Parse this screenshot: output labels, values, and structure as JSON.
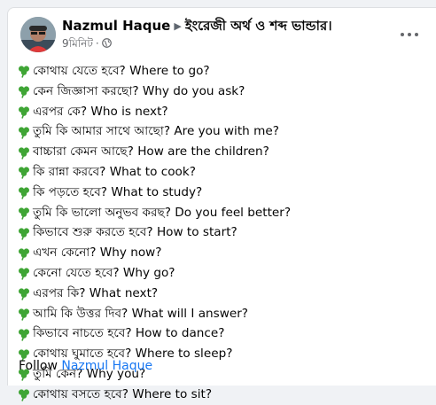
{
  "post": {
    "author": "Nazmul Haque",
    "group": "ইংরেজী অর্থ ও শব্দ ভান্ডার।",
    "time": "9মিনিট",
    "privacy_icon": "globe-icon",
    "more_icon": "more-options-icon",
    "line_icon": "shamrock-icon",
    "lines": [
      "কোথায় যেতে হবে? Where to go?",
      "কেন জিজ্ঞাসা করছো? Why do you ask?",
      "এরপর কে? Who is next?",
      "তুমি কি আমার সাথে আছো? Are you with me?",
      "বাচ্চারা কেমন আছে? How are the children?",
      "কি রান্না করবে? What to cook?",
      "কি পড়তে হবে? What to study?",
      "তুমি কি ভালো অনুভব করছ? Do you feel better?",
      "কিভাবে শুরু করতে হবে? How to start?",
      "এখন কেনো? Why now?",
      "কেনো যেতে হবে? Why go?",
      "এরপর কি? What next?",
      "আমি কি উত্তর দিব? What will I answer?",
      "কিভাবে নাচতে হবে? How to dance?",
      "কোথায় ঘুমাতে হবে? Where to sleep?",
      "তুমি কেন? Why you?",
      "কোথায় বসতে হবে? Where to sit?"
    ],
    "follow_text": "Follow",
    "follow_link": "Nazmul Haque"
  },
  "colors": {
    "link": "#1877f2",
    "clover": "#3fa535",
    "text": "#050505",
    "meta": "#65676b"
  }
}
